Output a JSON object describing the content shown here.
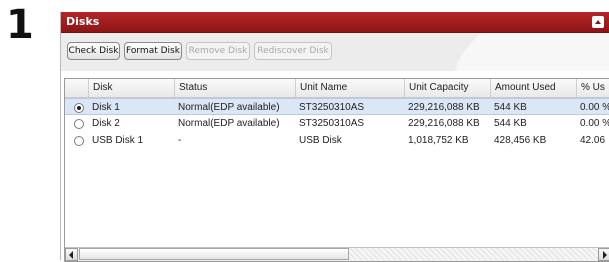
{
  "step_number": "1",
  "panel": {
    "title": "Disks"
  },
  "toolbar": {
    "check_disk": "Check Disk",
    "format_disk": "Format Disk",
    "remove_disk": "Remove Disk",
    "rediscover_disk": "Rediscover Disk"
  },
  "table": {
    "columns": [
      "Disk",
      "Status",
      "Unit Name",
      "Unit Capacity",
      "Amount Used",
      "% Us"
    ],
    "rows": [
      {
        "selected": true,
        "disk": "Disk 1",
        "status": "Normal(EDP available)",
        "unit_name": "ST3250310AS",
        "capacity": "229,216,088 KB",
        "used": "544 KB",
        "percent": "0.00 %"
      },
      {
        "selected": false,
        "disk": "Disk 2",
        "status": "Normal(EDP available)",
        "unit_name": "ST3250310AS",
        "capacity": "229,216,088 KB",
        "used": "544 KB",
        "percent": "0.00 %"
      },
      {
        "selected": false,
        "disk": "USB Disk 1",
        "status": "-",
        "unit_name": "USB Disk",
        "capacity": "1,018,752 KB",
        "used": "428,456 KB",
        "percent": "42.06"
      }
    ]
  },
  "colors": {
    "titlebar": "#a11d1f",
    "selected_row": "#dbe7f7"
  }
}
